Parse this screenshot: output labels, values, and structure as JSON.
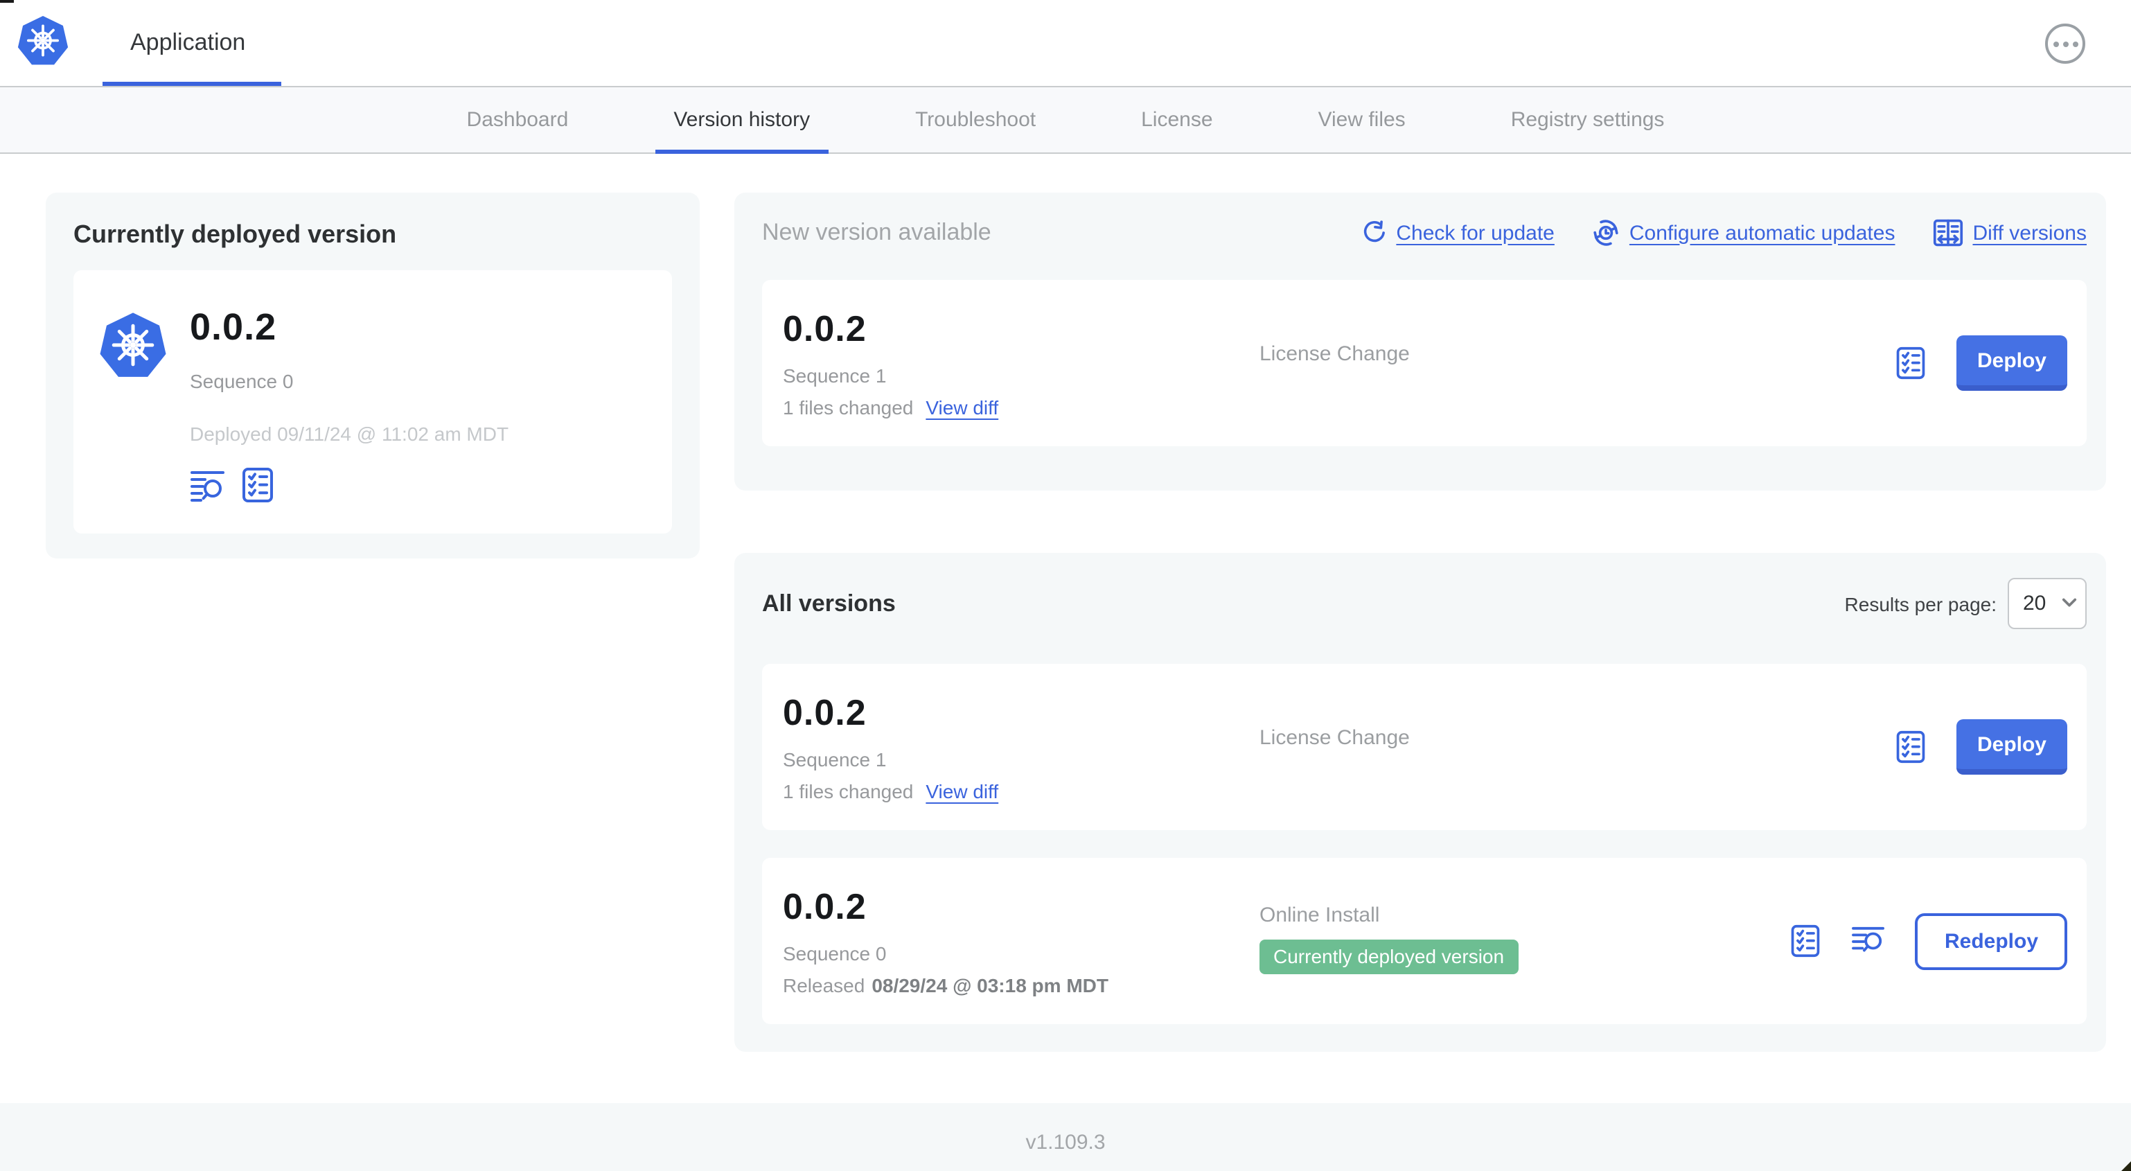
{
  "header": {
    "app_tab_label": "Application",
    "overflow_icon": "ellipsis-circle-icon"
  },
  "nav": {
    "tabs": [
      {
        "label": "Dashboard",
        "active": false
      },
      {
        "label": "Version history",
        "active": true
      },
      {
        "label": "Troubleshoot",
        "active": false
      },
      {
        "label": "License",
        "active": false
      },
      {
        "label": "View files",
        "active": false
      },
      {
        "label": "Registry settings",
        "active": false
      }
    ]
  },
  "current_version_card": {
    "title": "Currently deployed version",
    "version": "0.0.2",
    "sequence": "Sequence 0",
    "deployed_at": "Deployed 09/11/24 @ 11:02 am MDT",
    "icons": [
      "view-logs-icon",
      "preflight-checks-icon"
    ]
  },
  "new_version_card": {
    "title": "New version available",
    "actions": [
      {
        "label": "Check for update",
        "icon": "refresh-icon"
      },
      {
        "label": "Configure automatic updates",
        "icon": "update-schedule-icon"
      },
      {
        "label": "Diff versions",
        "icon": "diff-icon"
      }
    ],
    "row": {
      "version": "0.0.2",
      "sequence": "Sequence 1",
      "changes": "1 files changed",
      "view_diff_label": "View diff",
      "source": "License Change",
      "deploy_label": "Deploy"
    }
  },
  "all_versions_card": {
    "title": "All versions",
    "results_per_page_label": "Results per page:",
    "results_per_page_value": "20",
    "rows": [
      {
        "version": "0.0.2",
        "sequence": "Sequence 1",
        "changes": "1 files changed",
        "view_diff_label": "View diff",
        "source": "License Change",
        "deploy_label": "Deploy"
      },
      {
        "version": "0.0.2",
        "sequence": "Sequence 0",
        "released_prefix": "Released",
        "released_date": "08/29/24 @ 03:18 pm MDT",
        "source": "Online Install",
        "badge": "Currently deployed version",
        "redeploy_label": "Redeploy"
      }
    ]
  },
  "footer": {
    "version": "v1.109.3"
  },
  "colors": {
    "accent_blue": "#3a63dd",
    "button_blue": "#4571e4",
    "badge_green": "#6dbe92",
    "card_gray": "#f5f8f9"
  }
}
